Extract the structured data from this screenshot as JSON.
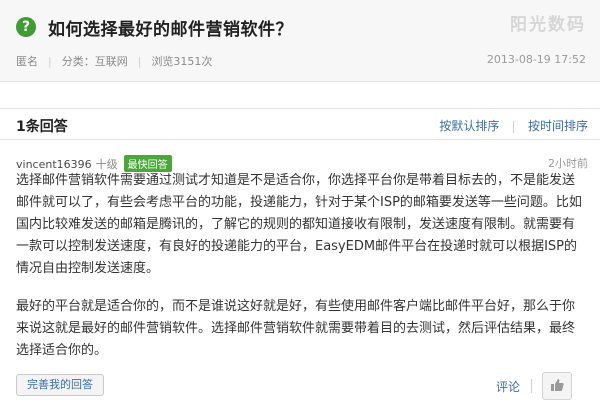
{
  "question": {
    "icon": "question-mark-icon",
    "icon_glyph": "?",
    "title": "如何选择最好的邮件营销软件？",
    "watermark": "阳光数码",
    "author": "匿名",
    "category": "分类：互联网",
    "views": "浏览3151次",
    "time": "2013-08-19 17:52"
  },
  "answers_bar": {
    "count": "1条回答",
    "sort_default": "按默认排序",
    "sort_time": "按时间排序"
  },
  "answer": {
    "username": "vincent16396",
    "level": "十级",
    "badge": "最快回答",
    "time": "2小时前",
    "paragraph1": "选择邮件营销软件需要通过测试才知道是不是适合你，你选择平台你是带着目标去的，不是能发送邮件就可以了，有些会考虑平台的功能，投递能力，针对于某个ISP的邮箱要发送等一些问题。比如国内比较难发送的邮箱是腾讯的，了解它的规则的都知道接收有限制，发送速度有限制。就需要有一款可以控制发送速度，有良好的投递能力的平台，EasyEDM邮件平台在投递时就可以根据ISP的情况自由控制发送速度。",
    "paragraph2": "最好的平台就是适合你的，而不是谁说这好就是好，有些使用邮件客户端比邮件平台好，那么于你来说这就是最好的邮件营销软件。选择邮件营销软件就需要带着目的去测试，然后评估结果，最终选择适合你的。"
  },
  "footer": {
    "improve_button": "完善我的回答",
    "comment": "评论"
  },
  "colors": {
    "accent_green": "#3f9b32",
    "link_blue": "#3a6ea5"
  }
}
